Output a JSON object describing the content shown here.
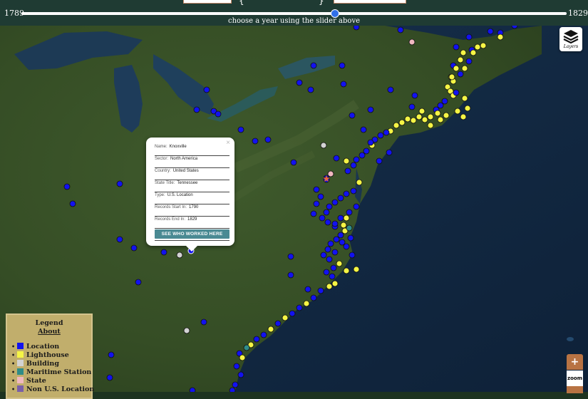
{
  "slider": {
    "min_label": "1789",
    "max_label": "1829",
    "hint": "choose a year using the slider above",
    "fraction": 0.575
  },
  "layers_button": {
    "label": "Layers",
    "icon": "layers-icon"
  },
  "popup": {
    "fields": [
      {
        "key": "Name:",
        "value": "Knoxville"
      },
      {
        "key": "Sector:",
        "value": "North America"
      },
      {
        "key": "Country:",
        "value": "United States"
      },
      {
        "key": "State Title:",
        "value": "Tennessee"
      },
      {
        "key": "Type:",
        "value": "U.S. Location"
      },
      {
        "key": "Records Start In:",
        "value": "1790"
      },
      {
        "key": "Records End In:",
        "value": "1829"
      }
    ],
    "button": "SEE WHO WORKED HERE",
    "close": "×"
  },
  "legend": {
    "title": "Legend",
    "about": "About",
    "items": [
      {
        "label": "Location",
        "color": "#1212f0"
      },
      {
        "label": "Lighthouse",
        "color": "#f5f545"
      },
      {
        "label": "Building",
        "color": "#d3d3d3"
      },
      {
        "label": "Maritime Station",
        "color": "#2f8c87"
      },
      {
        "label": "State",
        "color": "#f0b8c0"
      },
      {
        "label": "Non U.S. Location",
        "color": "#7a5fa8"
      }
    ]
  },
  "zoom": {
    "plus": "+",
    "label": "zoom"
  }
}
